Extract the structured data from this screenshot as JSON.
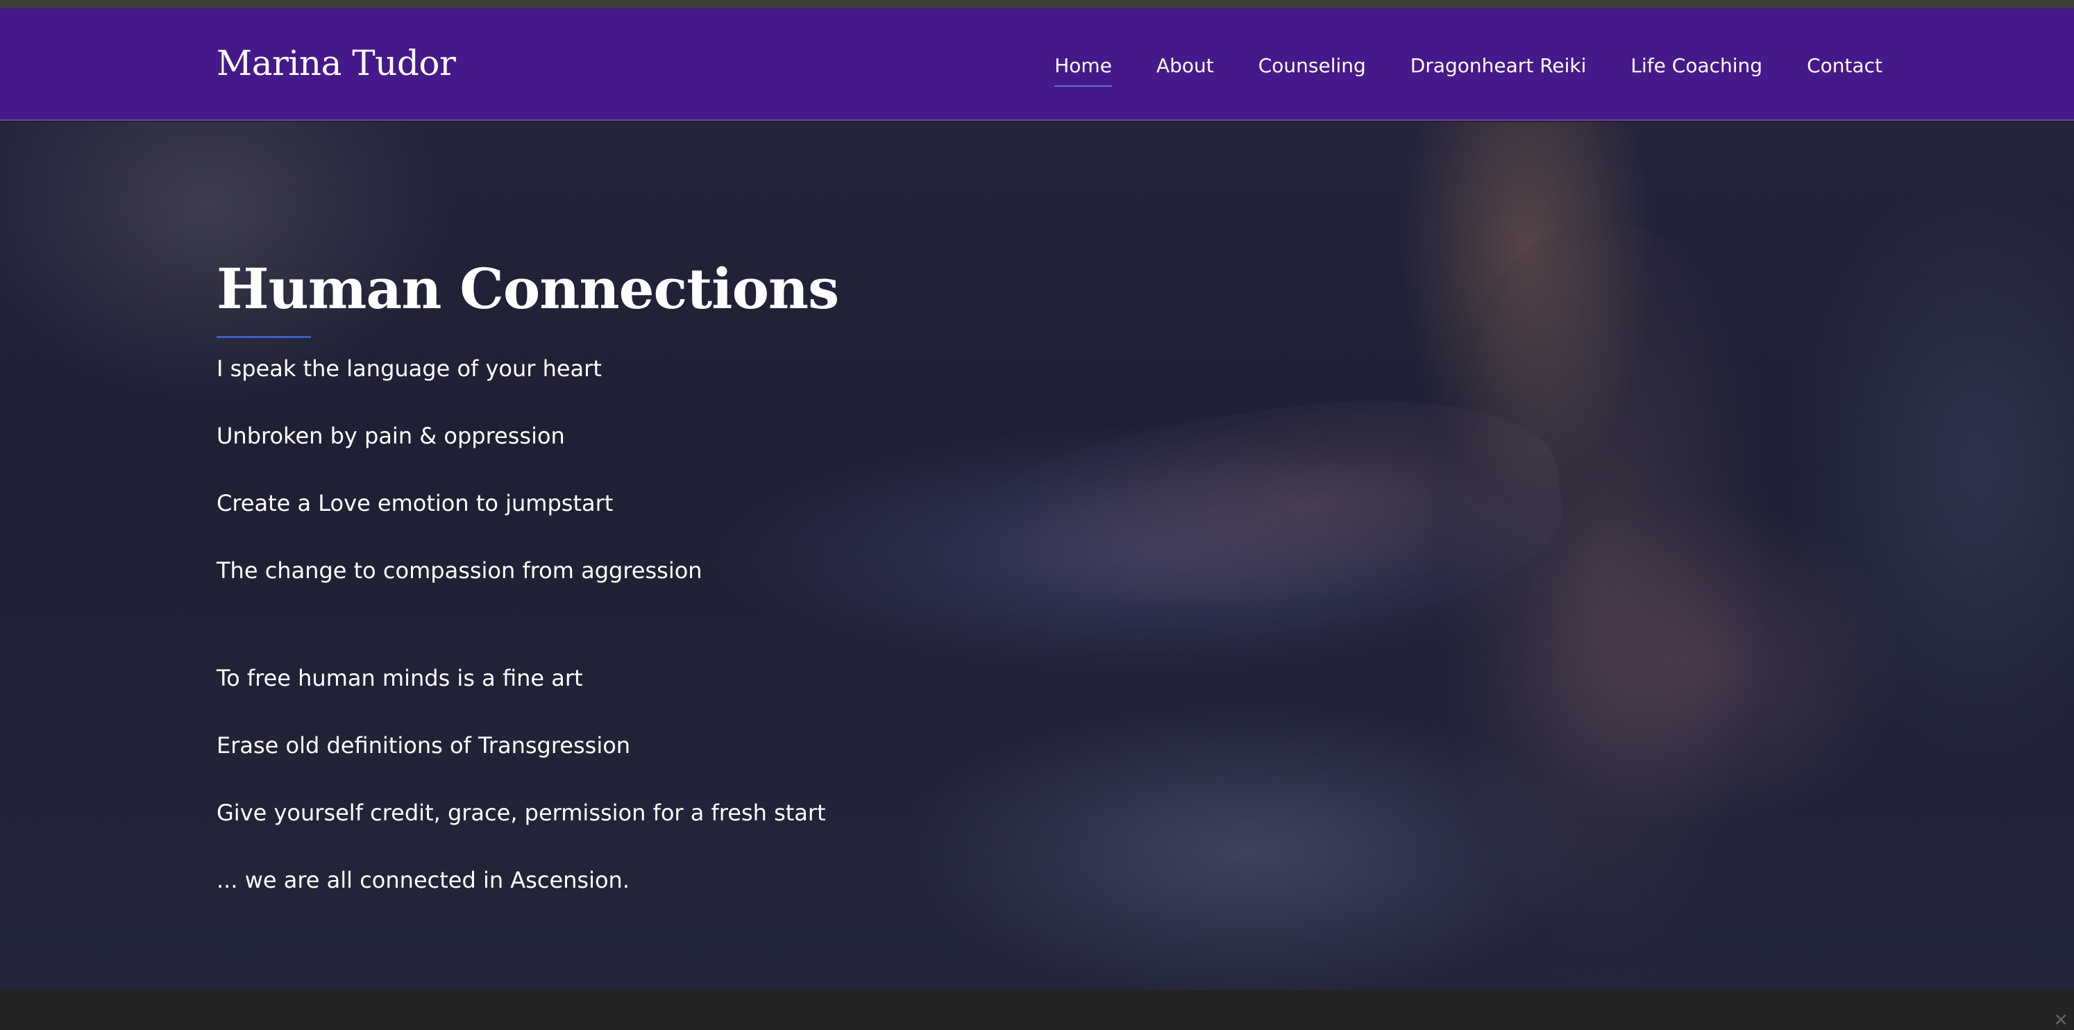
{
  "header": {
    "brand": "Marina Tudor",
    "nav": [
      {
        "label": "Home",
        "active": true
      },
      {
        "label": "About",
        "active": false
      },
      {
        "label": "Counseling",
        "active": false
      },
      {
        "label": "Dragonheart Reiki",
        "active": false
      },
      {
        "label": "Life Coaching",
        "active": false
      },
      {
        "label": "Contact",
        "active": false
      }
    ]
  },
  "hero": {
    "title": "Human Connections",
    "lines": [
      "I speak the language of your heart",
      "Unbroken by pain & oppression",
      "Create a Love emotion to jumpstart",
      "The change to compassion from aggression",
      "To free human minds is a fine art",
      "Erase old definitions of Transgression",
      "Give yourself credit, grace, permission for a fresh start",
      "... we are all connected in Ascension."
    ]
  },
  "footer": {
    "close_glyph": "×"
  },
  "colors": {
    "header_bg": "#46198a",
    "accent_rule": "#3f5cc8",
    "footer_bg": "#232323"
  },
  "icons": {
    "close": "close-icon"
  }
}
